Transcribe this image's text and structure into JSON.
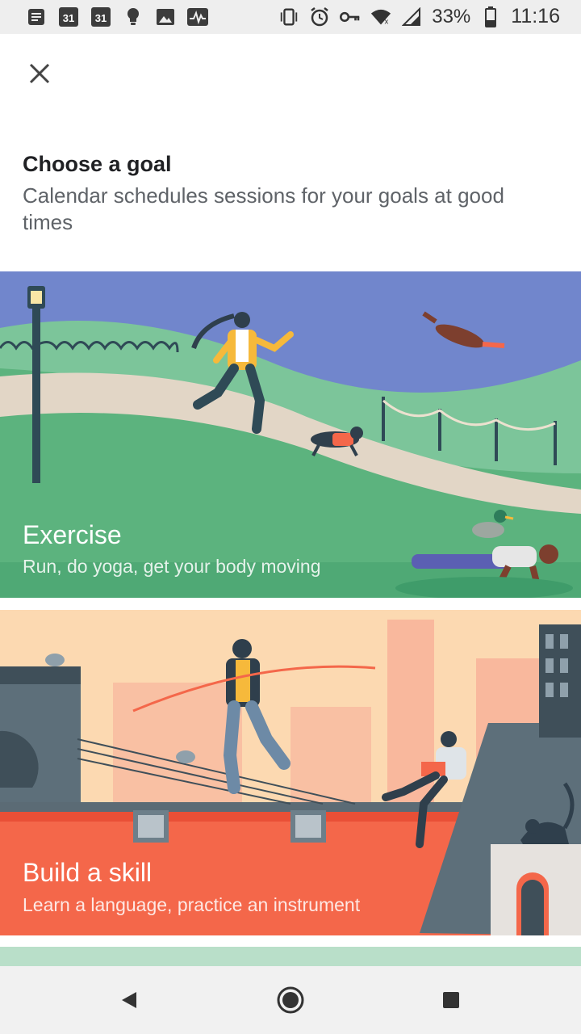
{
  "status_bar": {
    "calendar_day_1": "31",
    "calendar_day_2": "31",
    "battery_percent": "33%",
    "time": "11:16",
    "left_icons": [
      "notes-icon",
      "calendar-icon",
      "calendar-icon",
      "lightbulb-icon",
      "image-icon",
      "activity-icon"
    ],
    "right_icons": [
      "vibrate-icon",
      "alarm-icon",
      "vpn-key-icon",
      "wifi-icon",
      "signal-icon",
      "battery-icon"
    ]
  },
  "header": {
    "close_icon": "close-icon",
    "title": "Choose a goal",
    "subtitle": "Calendar schedules sessions for your goals at good times"
  },
  "goals": [
    {
      "title": "Exercise",
      "description": "Run, do yoga, get your body moving"
    },
    {
      "title": "Build a skill",
      "description": "Learn a language, practice an instrument"
    }
  ],
  "nav_bar": {
    "back_icon": "back-triangle-icon",
    "home_icon": "home-circle-icon",
    "recents_icon": "recents-square-icon"
  },
  "colors": {
    "exercise_sky": "#7186cc",
    "exercise_grass": "#5cb37e",
    "skill_sky": "#fcd9b1",
    "skill_roof": "#f4674a",
    "next_card_peek": "#b9dfc9"
  }
}
